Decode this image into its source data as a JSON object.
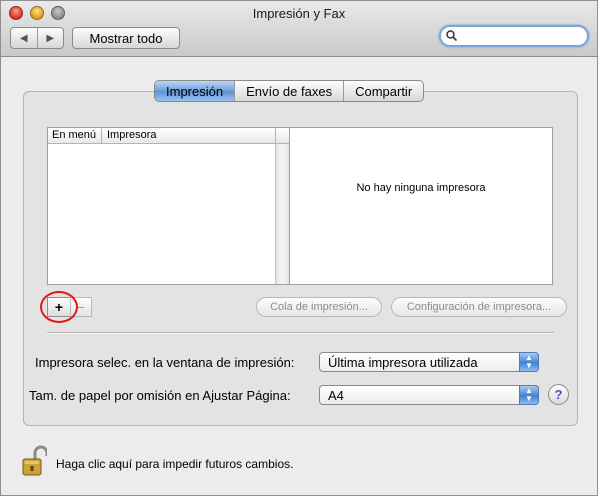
{
  "window": {
    "title": "Impresión y Fax"
  },
  "toolbar": {
    "back_icon": "◀",
    "forward_icon": "▶",
    "show_all_label": "Mostrar todo",
    "search_icon": "🔍",
    "search_value": ""
  },
  "tabs": [
    {
      "label": "Impresión",
      "active": true
    },
    {
      "label": "Envío de faxes",
      "active": false
    },
    {
      "label": "Compartir",
      "active": false
    }
  ],
  "printer_list": {
    "columns": [
      "En menú",
      "Impresora"
    ],
    "rows": []
  },
  "detail": {
    "empty_message": "No hay ninguna impresora"
  },
  "buttons": {
    "add": "+",
    "remove": "−",
    "print_queue": "Cola de impresión...",
    "printer_setup": "Configuración de impresora..."
  },
  "settings": {
    "selected_printer_label": "Impresora selec. en la ventana de impresión:",
    "selected_printer_value": "Última impresora utilizada",
    "paper_size_label": "Tam. de papel por omisión en Ajustar Página:",
    "paper_size_value": "A4"
  },
  "help_label": "?",
  "lock_message": "Haga clic aquí para impedir futuros cambios.",
  "colors": {
    "accent": "#5a90d6",
    "highlight_circle": "#e01818"
  }
}
